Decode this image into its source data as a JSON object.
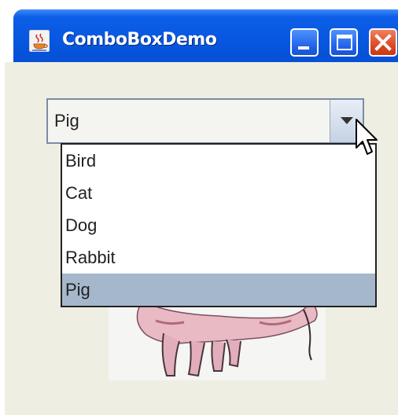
{
  "window": {
    "title": "ComboBoxDemo",
    "app_icon": "java-coffee-icon"
  },
  "combo": {
    "selected_value": "Pig"
  },
  "dropdown": {
    "items": [
      {
        "label": "Bird"
      },
      {
        "label": "Cat"
      },
      {
        "label": "Dog"
      },
      {
        "label": "Rabbit"
      },
      {
        "label": "Pig"
      }
    ],
    "selected_index": 4
  },
  "image": {
    "subject": "pig-illustration"
  },
  "colors": {
    "titlebar": "#0757e0",
    "client": "#eeeee2",
    "selection": "#a5b7cb",
    "close_button": "#d8431e"
  }
}
